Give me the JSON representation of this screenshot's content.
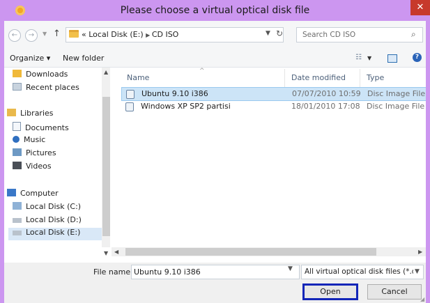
{
  "window": {
    "title": "Please choose a virtual optical disk file",
    "close_label": "✕"
  },
  "nav": {
    "address": [
      "Local Disk (E:)",
      "CD ISO"
    ],
    "address_prefix": "«",
    "search_placeholder": "Search CD ISO"
  },
  "toolbar": {
    "organize_label": "Organize ▾",
    "new_folder_label": "New folder"
  },
  "nav_pane": {
    "items": [
      {
        "label": "Downloads",
        "icon": "downloads-icon"
      },
      {
        "label": "Recent places",
        "icon": "recent-places-icon"
      },
      {
        "label": "Libraries",
        "icon": "libraries-icon"
      },
      {
        "label": "Documents",
        "icon": "documents-icon"
      },
      {
        "label": "Music",
        "icon": "music-icon"
      },
      {
        "label": "Pictures",
        "icon": "pictures-icon"
      },
      {
        "label": "Videos",
        "icon": "videos-icon"
      },
      {
        "label": "Computer",
        "icon": "computer-icon"
      },
      {
        "label": "Local Disk (C:)",
        "icon": "disk-icon"
      },
      {
        "label": "Local Disk (D:)",
        "icon": "disk-icon"
      },
      {
        "label": "Local Disk (E:)",
        "icon": "disk-icon",
        "selected": true
      }
    ]
  },
  "file_list": {
    "columns": [
      "Name",
      "Date modified",
      "Type"
    ],
    "rows": [
      {
        "name": "Ubuntu 9.10 i386",
        "date": "07/07/2010 10:59",
        "type": "Disc Image File",
        "selected": true
      },
      {
        "name": "Windows XP SP2 partisi",
        "date": "18/01/2010 17:08",
        "type": "Disc Image File",
        "selected": false
      }
    ]
  },
  "footer": {
    "file_name_label": "File name:",
    "file_name_value": "Ubuntu 9.10 i386",
    "filter_value": "All virtual optical disk files (*.dr",
    "open_label": "Open",
    "cancel_label": "Cancel"
  },
  "colors": {
    "title_bar": "#cc96f0",
    "close_button": "#c7392c",
    "selection": "#cce4f7",
    "open_button_border": "#1225b8"
  }
}
